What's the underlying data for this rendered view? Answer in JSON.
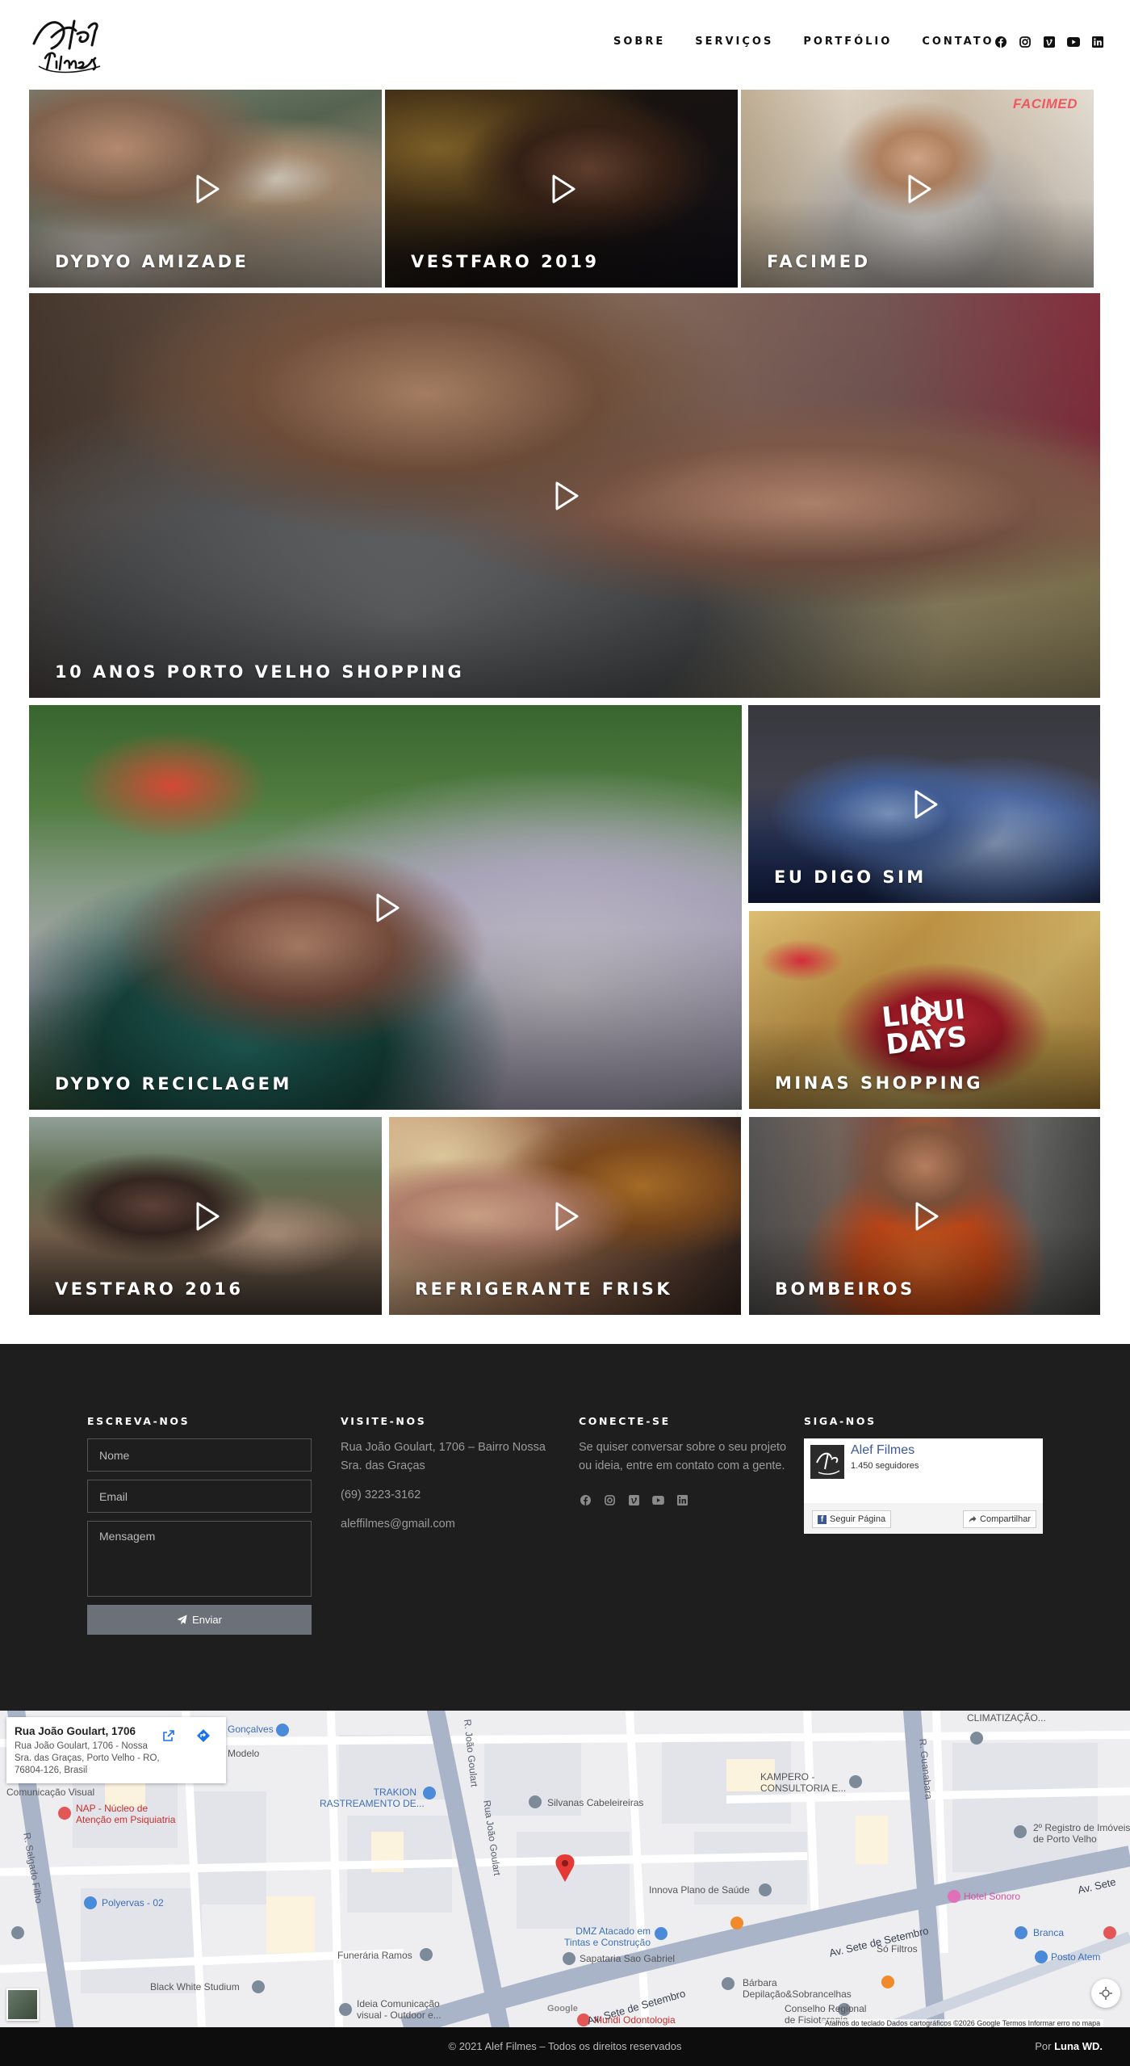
{
  "nav": {
    "items": [
      "SOBRE",
      "SERVIÇOS",
      "PORTFÓLIO",
      "CONTATO"
    ]
  },
  "header_social_icons": [
    "facebook-icon",
    "instagram-icon",
    "vimeo-icon",
    "youtube-icon",
    "linkedin-icon"
  ],
  "portfolio": {
    "tiles": [
      {
        "title": "DYDYO AMIZADE"
      },
      {
        "title": "VESTFARO 2019"
      },
      {
        "title": "FACIMED",
        "logo_text": "FACIMED"
      },
      {
        "title": "10 ANOS PORTO VELHO SHOPPING"
      },
      {
        "title": "DYDYO RECICLAGEM"
      },
      {
        "title": "EU DIGO SIM"
      },
      {
        "title": "MINAS SHOPPING",
        "art_text": [
          "LIQUI",
          "DAYS"
        ]
      },
      {
        "title": "VESTFARO 2016"
      },
      {
        "title": "REFRIGERANTE FRISK"
      },
      {
        "title": "BOMBEIROS"
      }
    ]
  },
  "footer": {
    "write": {
      "heading": "ESCREVA-NOS",
      "name_placeholder": "Nome",
      "email_placeholder": "Email",
      "message_placeholder": "Mensagem",
      "send_label": "Enviar"
    },
    "visit": {
      "heading": "VISITE-NOS",
      "address": "Rua João Goulart, 1706 – Bairro Nossa Sra. das Graças",
      "phone": "(69) 3223-3162",
      "email": "aleffilmes@gmail.com"
    },
    "connect": {
      "heading": "CONECTE-SE",
      "text": "Se quiser conversar sobre o seu projeto ou ideia, entre em contato com a gente."
    },
    "follow": {
      "heading": "SIGA-NOS",
      "page_name": "Alef Filmes",
      "followers": "1.450 seguidores",
      "follow_label": "Seguir Página",
      "share_label": "Compartilhar"
    }
  },
  "map": {
    "card_title": "Rua João Goulart, 1706",
    "card_address": "Rua João Goulart, 1706 - Nossa Sra. das Graças, Porto Velho - RO, 76804-126, Brasil",
    "labels": {
      "goncalves": "Gonçalves",
      "modelo": "Modelo",
      "comunicacao_visual": "Comunicação Visual",
      "nap": "NAP - Núcleo de",
      "nap2": "Atenção em Psiquiatria",
      "traquion": "TRAKION",
      "traquion2": "RASTREAMENTO DE...",
      "silvanas": "Silvanas Cabeleireiras",
      "kampero": "KAMPERO -",
      "kampero2": "CONSULTORIA E...",
      "climatizacao": "CLIMATIZAÇÃO...",
      "registro": "2º Registro de Imóveis",
      "registro2": "de Porto Velho",
      "polyervas": "Polyervas - 02",
      "innova": "Innova Plano de Saúde",
      "hotel": "Hotel Sonoro",
      "dmz": "DMZ Atacado em",
      "dmz2": "Tintas e Construção",
      "funeraria": "Funerária Ramos",
      "sapataria": "Sapataria Sao Gabriel",
      "so_filtros": "Só Filtros",
      "branca": "Branca",
      "posto": "Posto Atem",
      "black_white": "Black White Studium",
      "ideia": "Ideia Comunicação",
      "ideia2": "visual - Outdoor e...",
      "barbara": "Bárbara",
      "barbara2": "Depilação&Sobrancelhas",
      "conselho": "Conselho Regional",
      "conselho2": "de Fisioterapia",
      "mundi": "Mundi Odontologia",
      "street_salgado": "R. Salgado Filho",
      "street_joao1": "R. João Goulart",
      "street_joao2": "Rua João Goulart",
      "street_guanabara": "R. Guanabara",
      "street_sete1": "Av. Sete de Setembro",
      "street_sete2": "Av. Sete de Setembro",
      "street_sete3": "Av. Sete"
    },
    "attribution": "Atalhos do teclado   Dados cartográficos ©2026 Google   Termos   Informar erro no mapa",
    "google": "Google"
  },
  "bottom": {
    "copyright": "© 2021 Alef Filmes – Todos os direitos reservados",
    "credit_prefix": "Por",
    "credit_name": "Luna WD."
  }
}
